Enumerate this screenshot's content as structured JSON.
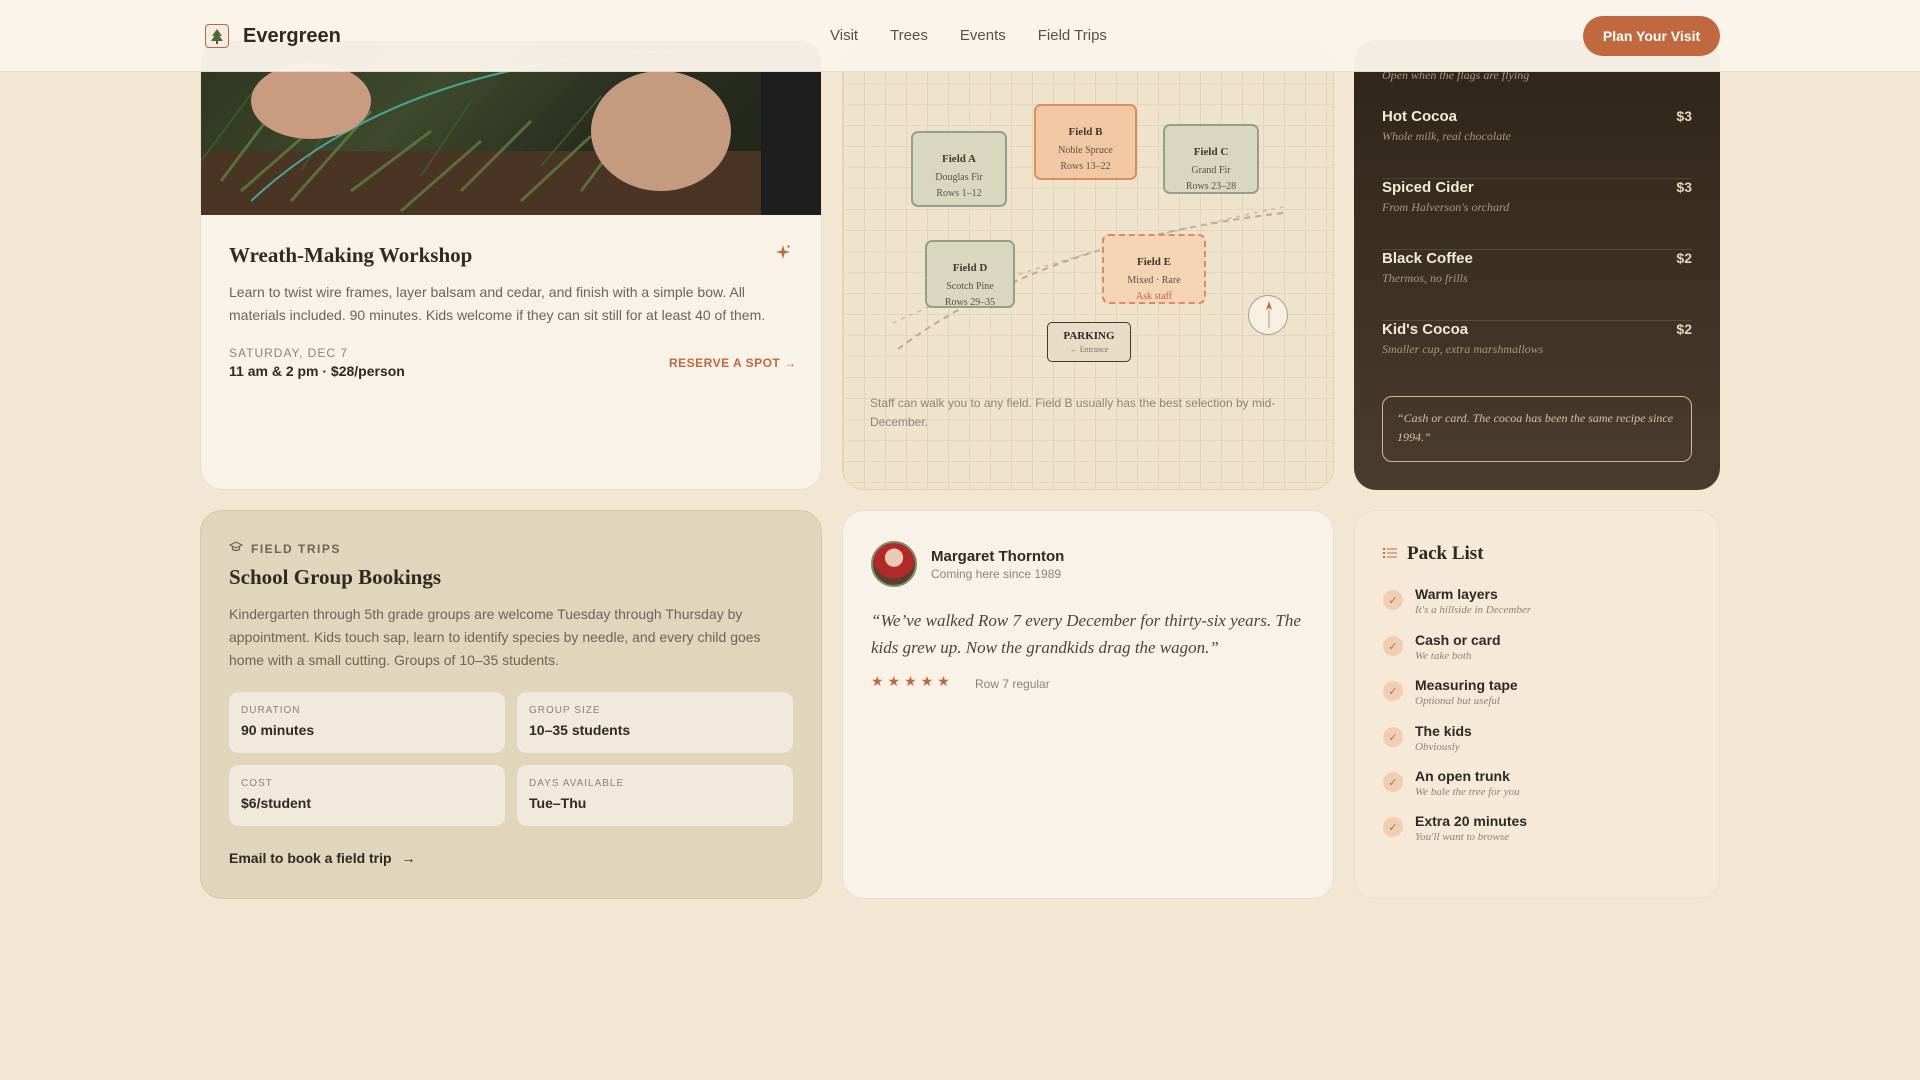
{
  "nav": {
    "brand": "Evergreen",
    "links": [
      "Visit",
      "Trees",
      "Events",
      "Field Trips"
    ],
    "cta": "Plan Your Visit"
  },
  "workshop": {
    "title": "Wreath-Making Workshop",
    "description": "Learn to twist wire frames, layer balsam and cedar, and finish with a simple bow. All materials included. 90 minutes. Kids welcome if they can sit still for at least 40 of them.",
    "date": "SATURDAY, DEC 7",
    "time": "11 am & 2 pm · $28/person",
    "reserve": "RESERVE A SPOT →"
  },
  "map": {
    "fields": [
      {
        "name": "Field A",
        "species": "Douglas Fir",
        "rows": "Rows 1–12"
      },
      {
        "name": "Field B",
        "species": "Noble Spruce",
        "rows": "Rows 13–22"
      },
      {
        "name": "Field C",
        "species": "Grand Fir",
        "rows": "Rows 23–28"
      },
      {
        "name": "Field D",
        "species": "Scotch Pine",
        "rows": "Rows 29–35"
      },
      {
        "name": "Field E",
        "species": "Mixed · Rare",
        "rows": "Ask staff"
      }
    ],
    "parking": "PARKING",
    "parking_sub": "← Entrance",
    "note": "Staff can walk you to any field. Field B usually has the best selection by mid-December."
  },
  "menu": {
    "top_note": "Open when the flags are flying",
    "items": [
      {
        "name": "Hot Cocoa",
        "price": "$3",
        "desc": "Whole milk, real chocolate"
      },
      {
        "name": "Spiced Cider",
        "price": "$3",
        "desc": "From Halverson's orchard"
      },
      {
        "name": "Black Coffee",
        "price": "$2",
        "desc": "Thermos, no frills"
      },
      {
        "name": "Kid's Cocoa",
        "price": "$2",
        "desc": "Smaller cup, extra marshmallows"
      }
    ],
    "quote": "“Cash or card. The cocoa has been the same recipe since 1994.”"
  },
  "trips": {
    "eyebrow": "FIELD TRIPS",
    "title": "School Group Bookings",
    "description": "Kindergarten through 5th grade groups are welcome Tuesday through Thursday by appointment. Kids touch sap, learn to identify species by needle, and every child goes home with a small cutting. Groups of 10–35 students.",
    "stats": [
      {
        "label": "DURATION",
        "value": "90 minutes"
      },
      {
        "label": "GROUP SIZE",
        "value": "10–35 students"
      },
      {
        "label": "COST",
        "value": "$6/student"
      },
      {
        "label": "DAYS AVAILABLE",
        "value": "Tue–Thu"
      }
    ],
    "link": "Email to book a field trip"
  },
  "testimonial": {
    "name": "Margaret Thornton",
    "since": "Coming here since 1989",
    "quote": "“We’ve walked Row 7 every December for thirty-six years. The kids grew up. Now the grandkids drag the wagon.”",
    "rating": 5,
    "stars": "★★★★★",
    "note": "Row 7 regular"
  },
  "pack": {
    "title": "Pack List",
    "items": [
      {
        "name": "Warm layers",
        "sub": "It's a hillside in December"
      },
      {
        "name": "Cash or card",
        "sub": "We take both"
      },
      {
        "name": "Measuring tape",
        "sub": "Optional but useful"
      },
      {
        "name": "The kids",
        "sub": "Obviously"
      },
      {
        "name": "An open trunk",
        "sub": "We bale the tree for you"
      },
      {
        "name": "Extra 20 minutes",
        "sub": "You'll want to browse"
      }
    ]
  },
  "colors": {
    "accent": "#c0693e",
    "page_bg": "#f3e6d2",
    "menu_bg": "#3a2e22",
    "field_green": "#92a28a"
  }
}
